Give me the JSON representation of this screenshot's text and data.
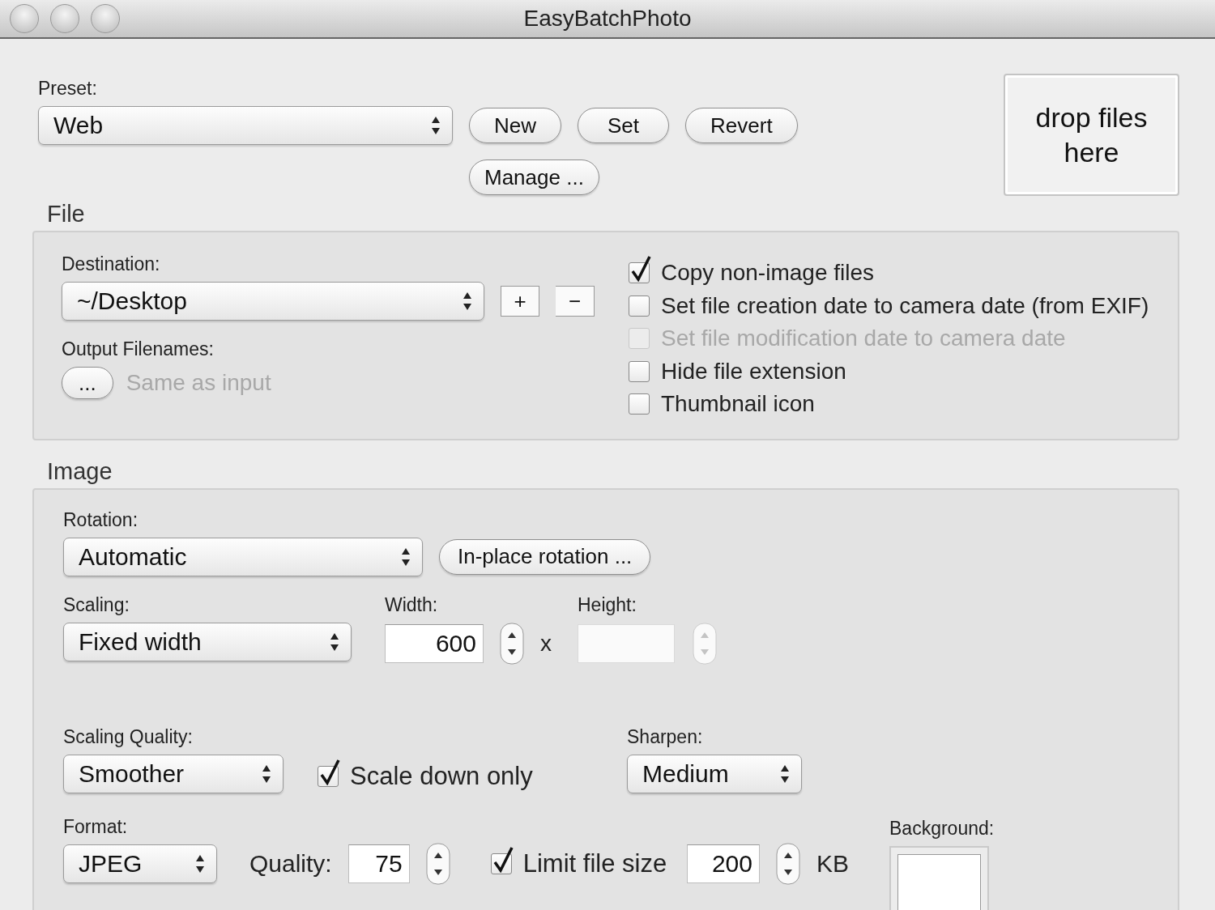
{
  "window": {
    "title": "EasyBatchPhoto"
  },
  "preset": {
    "label": "Preset:",
    "value": "Web",
    "buttons": [
      "New",
      "Set",
      "Revert"
    ],
    "manage_button": "Manage ..."
  },
  "drop_zone": {
    "text": "drop files here"
  },
  "file": {
    "title": "File",
    "destination": {
      "label": "Destination:",
      "value": "~/Desktop",
      "add": "+",
      "remove": "−"
    },
    "output": {
      "label": "Output Filenames:",
      "button": "...",
      "value": "Same as input"
    },
    "options": [
      {
        "label": "Copy non-image files",
        "checked": true,
        "disabled": false
      },
      {
        "label": "Set file creation date to camera date (from EXIF)",
        "checked": false,
        "disabled": false
      },
      {
        "label": "Set file modification date to camera date",
        "checked": false,
        "disabled": true
      },
      {
        "label": "Hide file extension",
        "checked": false,
        "disabled": false
      },
      {
        "label": "Thumbnail icon",
        "checked": false,
        "disabled": false
      }
    ]
  },
  "image": {
    "title": "Image",
    "rotation": {
      "label": "Rotation:",
      "value": "Automatic",
      "button": "In-place rotation ..."
    },
    "scaling": {
      "label": "Scaling:",
      "value": "Fixed width"
    },
    "width": {
      "label": "Width:",
      "value": "600",
      "disabled": false
    },
    "times": "x",
    "height": {
      "label": "Height:",
      "disabled": true
    },
    "scaling_quality": {
      "label": "Scaling Quality:",
      "value": "Smoother"
    },
    "scale_down_only": {
      "label": "Scale down only",
      "checked": true
    },
    "sharpen": {
      "label": "Sharpen:",
      "value": "Medium"
    },
    "format": {
      "label": "Format:",
      "value": "JPEG"
    },
    "quality": {
      "label": "Quality:",
      "value": "75",
      "disabled": false
    },
    "limit_file_size": {
      "label": "Limit file size",
      "checked": true,
      "value": "200",
      "unit": "KB"
    },
    "background": {
      "label": "Background:"
    }
  }
}
